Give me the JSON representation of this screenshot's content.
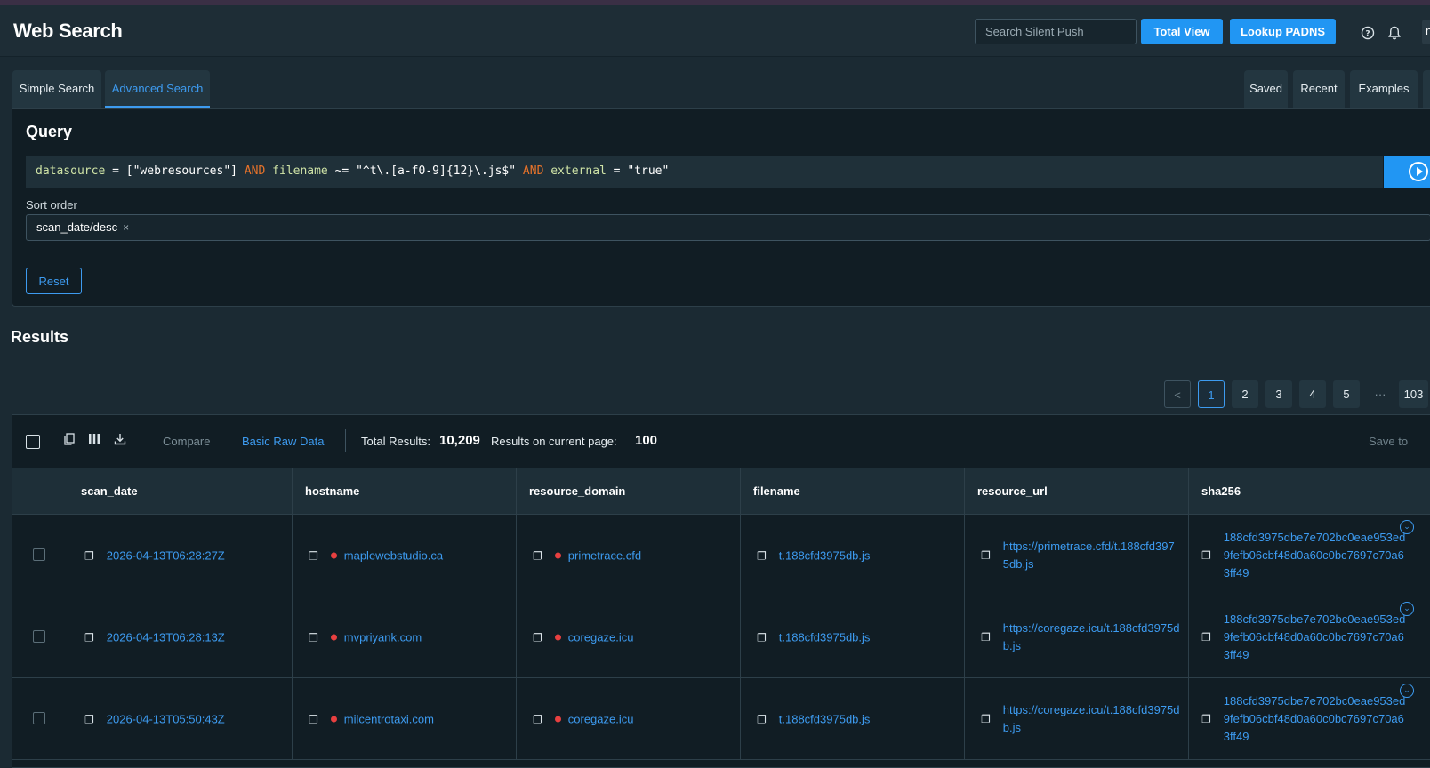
{
  "header": {
    "title": "Web Search",
    "search_placeholder": "Search Silent Push",
    "total_view_label": "Total View",
    "lookup_label": "Lookup PADNS",
    "help_icon": "help-circle-icon",
    "bell_icon": "bell-icon",
    "avatar_initial": "n"
  },
  "tabs": {
    "simple": "Simple Search",
    "advanced": "Advanced Search",
    "saved": "Saved",
    "recent": "Recent",
    "examples": "Examples"
  },
  "query": {
    "heading": "Query",
    "tokens": {
      "t1": "datasource",
      "t2": " = [\"webresources\"] ",
      "t3": "AND",
      "t4": " ",
      "t5": "filename",
      "t6": " ~= \"^t\\.[a-f0-9]{12}\\.js$\" ",
      "t7": "AND",
      "t8": " ",
      "t9": "external",
      "t10": " = \"true\""
    },
    "sort_label": "Sort order",
    "sort_value": "scan_date/desc",
    "sort_remove": "×",
    "reset_label": "Reset"
  },
  "results": {
    "heading": "Results",
    "pagination": {
      "prev": "<",
      "p1": "1",
      "p2": "2",
      "p3": "3",
      "p4": "4",
      "p5": "5",
      "ellipsis": "···",
      "last": "103",
      "current": 1
    },
    "toolbar": {
      "compare": "Compare",
      "basic_raw": "Basic Raw Data",
      "total_label": "Total Results:",
      "total_value": "10,209",
      "page_label": "Results on current page:",
      "page_value": "100",
      "save_to": "Save to"
    },
    "columns": {
      "c1": "scan_date",
      "c2": "hostname",
      "c3": "resource_domain",
      "c4": "filename",
      "c5": "resource_url",
      "c6": "sha256"
    },
    "rows": [
      {
        "scan_date": "2026-04-13T06:28:27Z",
        "hostname": "maplewebstudio.ca",
        "resource_domain": "primetrace.cfd",
        "filename": "t.188cfd3975db.js",
        "resource_url": "https://primetrace.cfd/t.188cfd3975db.js",
        "sha256": "188cfd3975dbe7e702bc0eae953ed9fefb06cbf48d0a60c0bc7697c70a63ff49"
      },
      {
        "scan_date": "2026-04-13T06:28:13Z",
        "hostname": "mvpriyank.com",
        "resource_domain": "coregaze.icu",
        "filename": "t.188cfd3975db.js",
        "resource_url": "https://coregaze.icu/t.188cfd3975db.js",
        "sha256": "188cfd3975dbe7e702bc0eae953ed9fefb06cbf48d0a60c0bc7697c70a63ff49"
      },
      {
        "scan_date": "2026-04-13T05:50:43Z",
        "hostname": "milcentrotaxi.com",
        "resource_domain": "coregaze.icu",
        "filename": "t.188cfd3975db.js",
        "resource_url": "https://coregaze.icu/t.188cfd3975db.js",
        "sha256": "188cfd3975dbe7e702bc0eae953ed9fefb06cbf48d0a60c0bc7697c70a63ff49"
      }
    ]
  },
  "colors": {
    "accent": "#2196f3",
    "link": "#3d9bf0",
    "risk_dot": "#e84040",
    "operator": "#e8732a"
  }
}
